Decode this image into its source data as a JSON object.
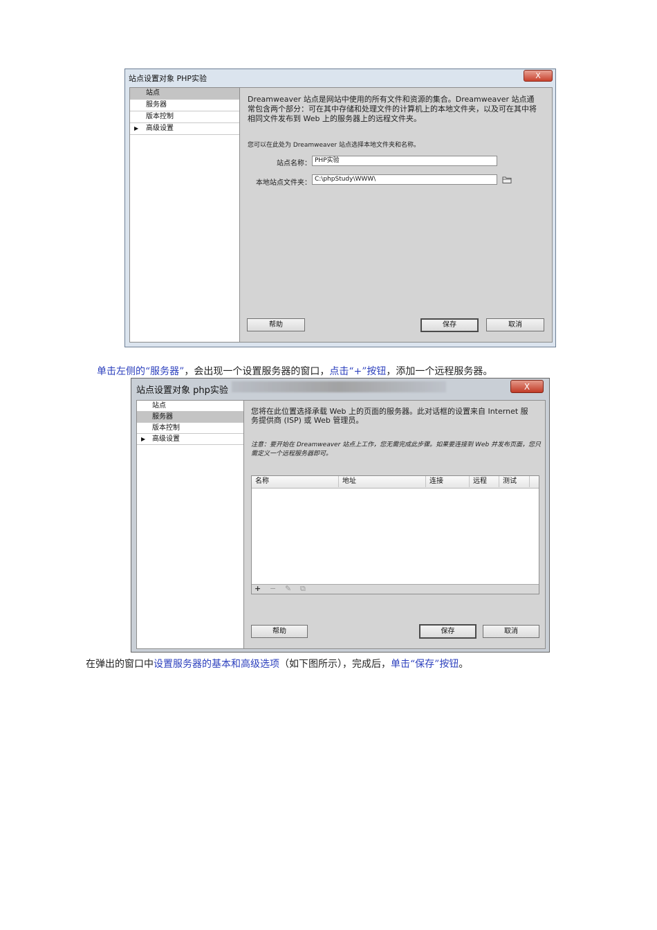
{
  "dialog1": {
    "title": "站点设置对象 PHP实验",
    "close_glyph": "X",
    "sidebar": [
      {
        "label": "站点",
        "selected": true,
        "arrow": ""
      },
      {
        "label": "服务器",
        "selected": false,
        "arrow": ""
      },
      {
        "label": "版本控制",
        "selected": false,
        "arrow": ""
      },
      {
        "label": "高级设置",
        "selected": false,
        "arrow": "▶"
      }
    ],
    "description": "Dreamweaver 站点是网站中使用的所有文件和资源的集合。Dreamweaver 站点通常包含两个部分：可在其中存储和处理文件的计算机上的本地文件夹，以及可在其中将相同文件发布到 Web 上的服务器上的远程文件夹。",
    "prompt": "您可以在此处为 Dreamweaver 站点选择本地文件夹和名称。",
    "site_name_label": "站点名称：",
    "site_name_value": "PHP实验",
    "local_folder_label": "本地站点文件夹：",
    "local_folder_value": "C:\\phpStudy\\WWW\\",
    "help_button": "帮助",
    "save_button": "保存",
    "cancel_button": "取消"
  },
  "instruction1": {
    "part1": "单击左侧的“服务器”",
    "part2": "，会出现一个设置服务器的窗口，",
    "part3": "点击“+”按钮",
    "part4": "，添加一个远程服务器。"
  },
  "dialog2": {
    "title": "站点设置对象 php实验",
    "close_glyph": "X",
    "sidebar": [
      {
        "label": "站点",
        "selected": false,
        "arrow": ""
      },
      {
        "label": "服务器",
        "selected": true,
        "arrow": ""
      },
      {
        "label": "版本控制",
        "selected": false,
        "arrow": ""
      },
      {
        "label": "高级设置",
        "selected": false,
        "arrow": "▶"
      }
    ],
    "description": "您将在此位置选择承载 Web 上的页面的服务器。此对话框的设置来自 Internet 服务提供商 (ISP) 或 Web 管理员。",
    "note": "注意：要开始在 Dreamweaver 站点上工作，您无需完成此步骤。如果要连接到 Web 并发布页面，您只需定义一个远程服务器即可。",
    "columns": [
      "名称",
      "地址",
      "连接",
      "远程",
      "测试"
    ],
    "toolbar": {
      "add": "+",
      "remove": "−",
      "edit": "✎",
      "duplicate": "⧉"
    },
    "help_button": "帮助",
    "save_button": "保存",
    "cancel_button": "取消"
  },
  "instruction2": {
    "part1": "在弹出的窗口中",
    "part2": "设置服务器的基本和高级选项",
    "part3": "（如下图所示），完成后，",
    "part4": "单击“保存”按钮",
    "part5": "。"
  },
  "colors": {
    "link_blue": "#2b3fbd",
    "close_red": "#c8422e",
    "panel_gray": "#d4d4d4"
  }
}
